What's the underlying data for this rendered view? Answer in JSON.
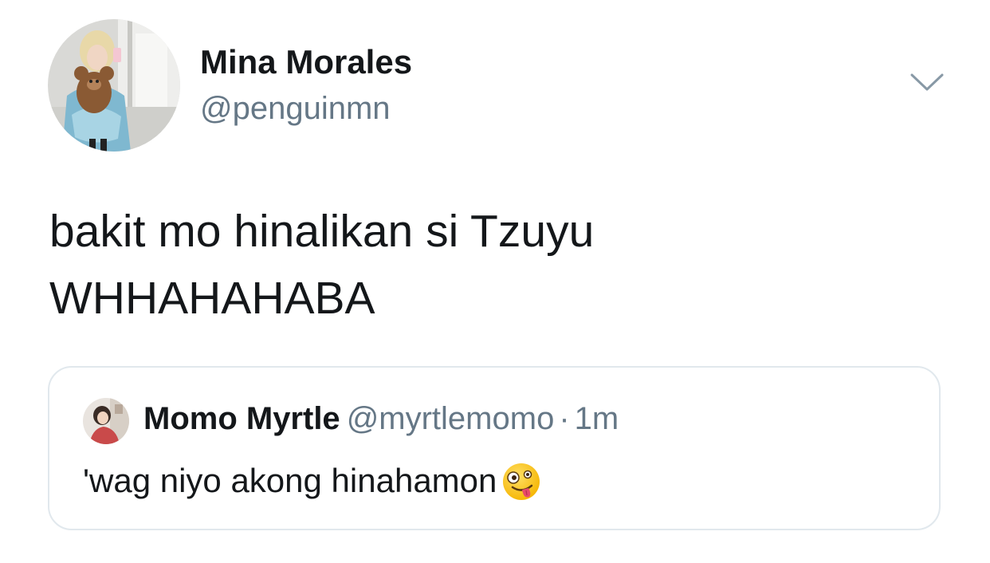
{
  "tweet": {
    "author": {
      "display_name": "Mina Morales",
      "handle": "@penguinmn",
      "avatar_icon": "profile-photo"
    },
    "menu_icon": "chevron-down-icon",
    "text_lines": [
      "bakit mo hinalikan si Tzuyu",
      "WHHAHAHABA"
    ],
    "quoted_tweet": {
      "display_name": "Momo Myrtle",
      "handle": "@myrtlemomo",
      "separator": "·",
      "time": "1m",
      "text": "'wag niyo akong hinahamon",
      "emoji_icon": "zany-face-icon"
    }
  },
  "colors": {
    "primary_text": "#14171a",
    "secondary_text": "#657786",
    "border": "#e1e8ed",
    "background": "#ffffff"
  }
}
